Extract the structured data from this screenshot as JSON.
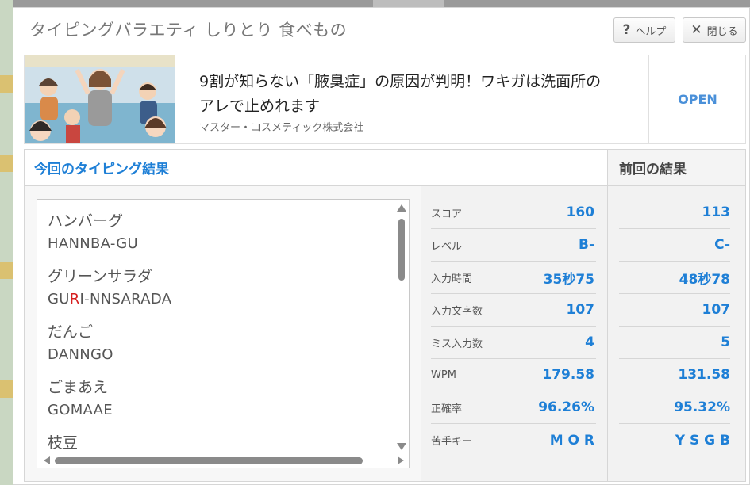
{
  "modal": {
    "title": "タイピングバラエティ しりとり 食べもの",
    "help_label": "ヘルプ",
    "close_label": "閉じる",
    "help_icon": "question-icon",
    "close_icon": "x-icon"
  },
  "ad": {
    "headline": "9割が知らない「腋臭症」の原因が判明！ワキガは洗面所のアレで止めれます",
    "sponsor": "マスター・コスメティック株式会社",
    "open_label": "OPEN"
  },
  "results": {
    "current_title": "今回のタイピング結果",
    "previous_title": "前回の結果",
    "words": [
      {
        "jp": "ハンバーグ",
        "romaji_pre": "HANNBA-GU",
        "miss": "",
        "romaji_post": ""
      },
      {
        "jp": "グリーンサラダ",
        "romaji_pre": "GU",
        "miss": "R",
        "romaji_post": "I-NNSARADA"
      },
      {
        "jp": "だんご",
        "romaji_pre": "DANNGO",
        "miss": "",
        "romaji_post": ""
      },
      {
        "jp": "ごまあえ",
        "romaji_pre": "GOMAAE",
        "miss": "",
        "romaji_post": ""
      },
      {
        "jp": "枝豆",
        "romaji_pre": "",
        "miss": "",
        "romaji_post": ""
      }
    ],
    "stats": [
      {
        "label": "スコア",
        "current": "160",
        "previous": "113"
      },
      {
        "label": "レベル",
        "current": "B-",
        "previous": "C-"
      },
      {
        "label": "入力時間",
        "current": "35秒75",
        "previous": "48秒78"
      },
      {
        "label": "入力文字数",
        "current": "107",
        "previous": "107"
      },
      {
        "label": "ミス入力数",
        "current": "4",
        "previous": "5"
      },
      {
        "label": "WPM",
        "current": "179.58",
        "previous": "131.58"
      },
      {
        "label": "正確率",
        "current": "96.26%",
        "previous": "95.32%"
      },
      {
        "label": "苦手キー",
        "current": "M O R",
        "previous": "Y S G B"
      }
    ]
  },
  "colors": {
    "accent": "#1e7fd6",
    "miss": "#d62020",
    "open": "#4a90d9"
  }
}
